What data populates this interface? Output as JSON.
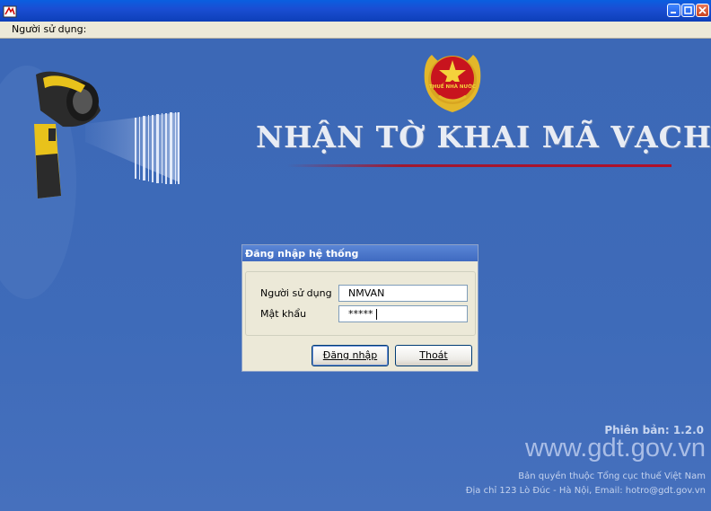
{
  "window": {
    "title": ""
  },
  "menu": {
    "items": [
      "Người sử dụng:"
    ]
  },
  "header": {
    "title": "NHẬN TỜ KHAI MÃ VẠCH",
    "emblem_text": "THUẾ NHÀ NƯỚC"
  },
  "login_dialog": {
    "title": "Đăng nhập hệ thống",
    "username_label": "Người sử dụng",
    "username_value": "NMVAN",
    "password_label": "Mật khẩu",
    "password_value": "*****",
    "login_button_label": "Đăng nhập",
    "exit_button_label": "Thoát"
  },
  "footer": {
    "version": "Phiên bản: 1.2.0",
    "website": "www.gdt.gov.vn",
    "copyright": "Bản quyền thuộc Tổng cục thuế Việt Nam",
    "address": "Địa chỉ 123 Lò Đúc - Hà Nội,  Email: hotro@gdt.gov.vn"
  },
  "icons": {
    "app": "app-icon",
    "minimize": "minimize-icon",
    "maximize": "maximize-icon",
    "close": "close-icon",
    "scanner": "barcode-scanner-icon",
    "emblem": "emblem-icon"
  },
  "colors": {
    "background": "#3d6ab8",
    "title_text": "#e8ecf4",
    "accent_line": "#b0102a",
    "titlebar": "#0a5fe0"
  }
}
